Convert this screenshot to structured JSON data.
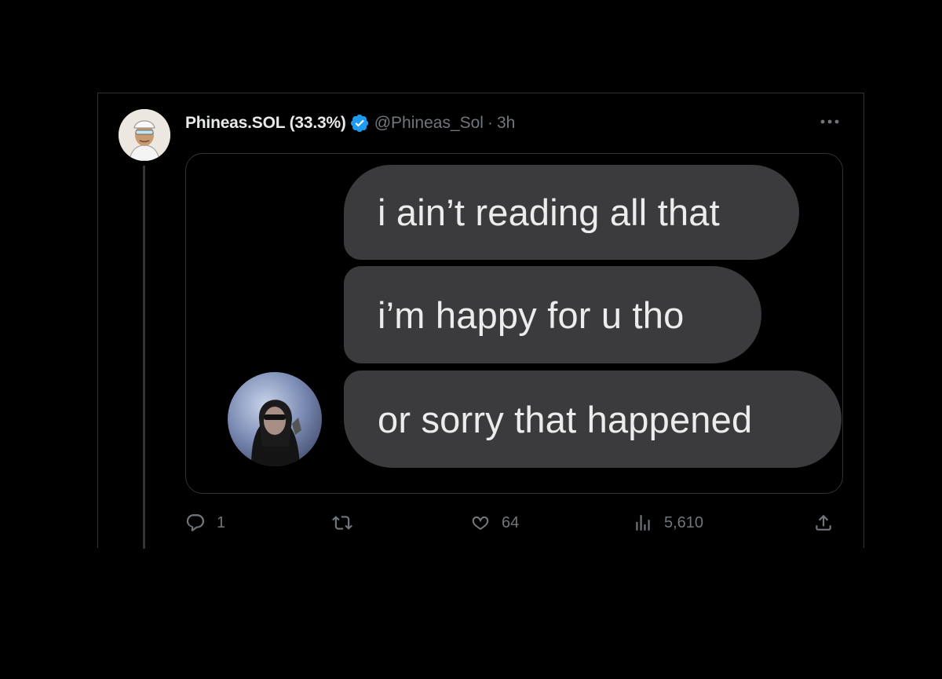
{
  "tweet": {
    "display_name": "Phineas.SOL (33.3%)",
    "handle": "@Phineas_Sol",
    "separator": "·",
    "time": "3h"
  },
  "media": {
    "messages": [
      "i ain’t reading all that",
      "i’m happy for u tho",
      "or sorry that happened"
    ]
  },
  "actions": {
    "reply_count": "1",
    "retweet_count": "",
    "like_count": "64",
    "view_count": "5,610"
  },
  "colors": {
    "background": "#000000",
    "text_primary": "#e7e9ea",
    "text_secondary": "#71767b",
    "verified": "#1d9bf0",
    "bubble": "#3b3b3d",
    "border": "#2f3336"
  },
  "icons": [
    "verified-badge-icon",
    "more-icon",
    "reply-icon",
    "retweet-icon",
    "like-icon",
    "views-icon",
    "share-icon"
  ]
}
